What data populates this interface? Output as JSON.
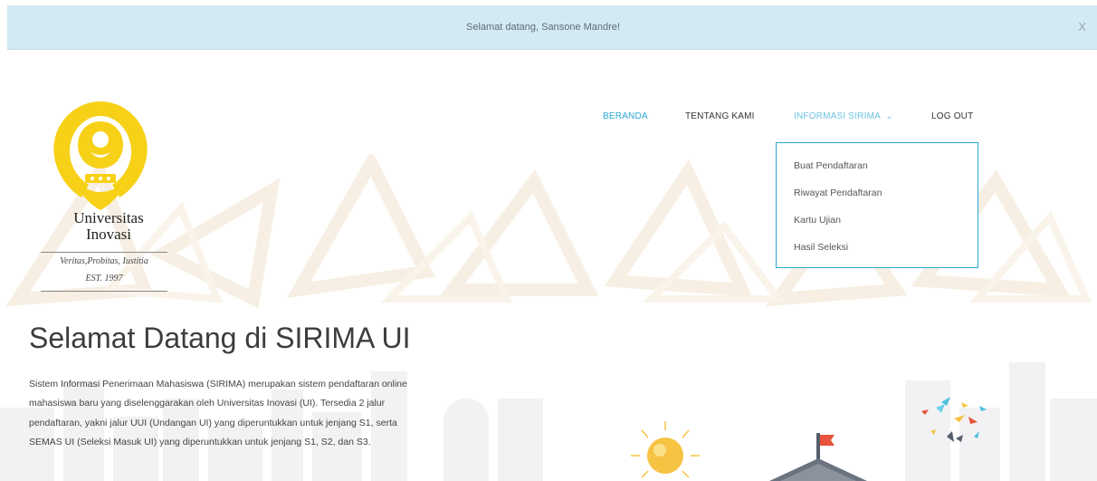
{
  "banner": {
    "message": "Selamat datang, Sansone Mandre!",
    "close_label": "X"
  },
  "logo": {
    "name_line1": "Universitas",
    "name_line2": "Inovasi",
    "motto": "Veritas,Probitas, Iustitia",
    "established": "EST. 1997"
  },
  "nav": {
    "items": [
      {
        "label": "BERANDA"
      },
      {
        "label": "TENTANG KAMI"
      },
      {
        "label": "INFORMASI SIRIMA",
        "caret": "⌄"
      },
      {
        "label": "LOG OUT"
      }
    ],
    "dropdown": [
      {
        "label": "Buat Pendaftaran"
      },
      {
        "label": "Riwayat Pendaftaran"
      },
      {
        "label": "Kartu Ujian"
      },
      {
        "label": "Hasil Seleksi"
      }
    ]
  },
  "main": {
    "title": "Selamat Datang di SIRIMA UI",
    "intro": "Sistem Informasi Penerimaan Mahasiswa (SIRIMA) merupakan sistem pendaftaran online mahasiswa baru yang diselenggarakan oleh Universitas Inovasi (UI). Tersedia 2 jalur pendaftaran, yakni jalur UUI (Undangan UI) yang diperuntukkan untuk jenjang S1, serta SEMAS UI (Seleksi Masuk UI) yang diperuntukkan untuk jenjang S1, S2, dan S3."
  },
  "colors": {
    "banner_bg": "#d3e9f3",
    "accent": "#2aa6d6",
    "logo_gold": "#f7d117",
    "flag_red": "#e8533a",
    "sun": "#f6c343"
  }
}
